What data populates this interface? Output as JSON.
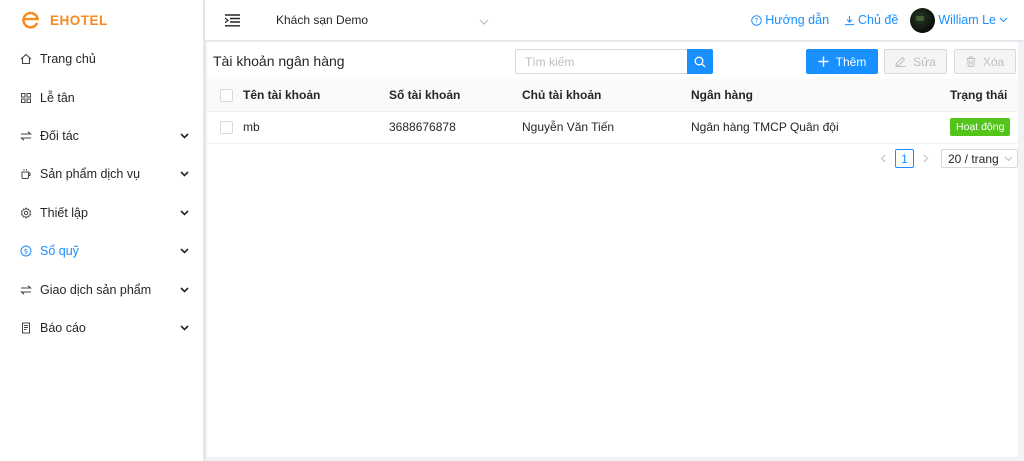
{
  "app": {
    "name": "EHOTEL",
    "brand_color": "#f58a1f"
  },
  "sidebar": {
    "items": [
      {
        "label": "Trang chủ",
        "icon": "home-icon",
        "has_children": false
      },
      {
        "label": "Lễ tân",
        "icon": "grid-icon",
        "has_children": false
      },
      {
        "label": "Đối tác",
        "icon": "swap-icon",
        "has_children": true
      },
      {
        "label": "Sản phẩm dịch vụ",
        "icon": "cup-icon",
        "has_children": true
      },
      {
        "label": "Thiết lập",
        "icon": "gear-icon",
        "has_children": true
      },
      {
        "label": "Sổ quỹ",
        "icon": "dollar-icon",
        "has_children": true,
        "active": true
      },
      {
        "label": "Giao dịch sản phẩm",
        "icon": "swap-icon",
        "has_children": true
      },
      {
        "label": "Báo cáo",
        "icon": "report-icon",
        "has_children": true
      }
    ]
  },
  "header": {
    "hotel_select": "Khách sạn Demo",
    "help_label": "Hướng dẫn",
    "theme_label": "Chủ đề",
    "user_name": "William Le"
  },
  "main": {
    "title": "Tài khoản ngân hàng",
    "search_placeholder": "Tìm kiếm",
    "add_label": "Thêm",
    "edit_label": "Sửa",
    "delete_label": "Xóa",
    "table": {
      "columns": [
        "Tên tài khoản",
        "Số tài khoản",
        "Chủ tài khoản",
        "Ngân hàng",
        "Trạng thái"
      ],
      "rows": [
        {
          "account_name": "mb",
          "account_number": "3688676878",
          "owner": "Nguyễn Văn Tiến",
          "bank": "Ngân hàng TMCP Quân đội",
          "status": "Hoạt động"
        }
      ]
    },
    "pagination": {
      "current_page": "1",
      "page_size": "20 / trang"
    }
  },
  "colors": {
    "primary": "#1890ff",
    "success": "#52c41a",
    "disabled_text": "#bfbfbf"
  }
}
